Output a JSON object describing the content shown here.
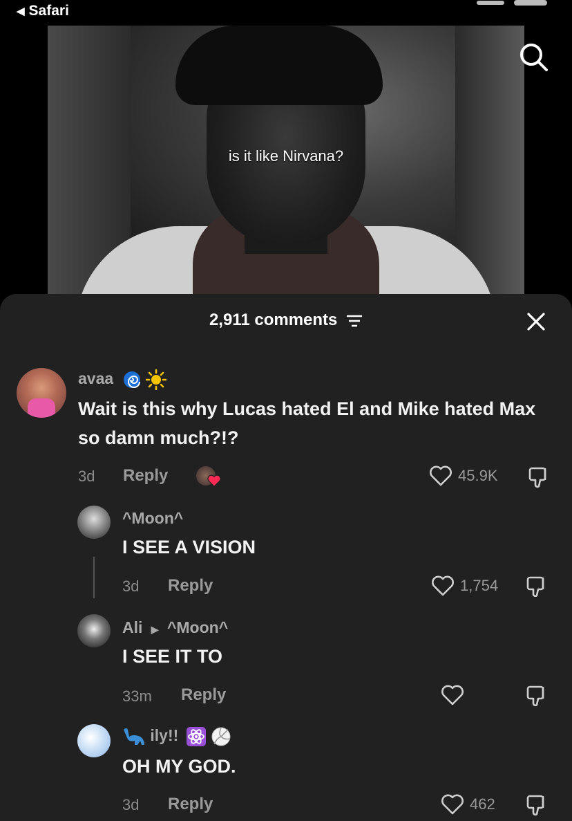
{
  "status_bar": {
    "back_label": "Safari"
  },
  "video": {
    "caption": "is it like Nirvana?"
  },
  "sheet": {
    "comments_count": "2,911 comments"
  },
  "comments": [
    {
      "username": "avaa",
      "text": "Wait is this why Lucas hated El and Mike hated Max so damn much?!?",
      "age": "3d",
      "reply_label": "Reply",
      "likes": "45.9K"
    },
    {
      "username": "^Moon^",
      "text": "I SEE A VISION",
      "age": "3d",
      "reply_label": "Reply",
      "likes": "1,754"
    },
    {
      "username": "Ali",
      "reply_to": "^Moon^",
      "text": "I SEE IT TO",
      "age": "33m",
      "reply_label": "Reply",
      "likes": ""
    },
    {
      "username": "ily!!",
      "text": "OH MY GOD.",
      "age": "3d",
      "reply_label": "Reply",
      "likes": "462"
    }
  ],
  "colors": {
    "sheet_bg": "#222122",
    "heart_red": "#ff2b55",
    "text_muted": "#9a9a9a"
  },
  "icons": [
    "back-triangle-icon",
    "search-icon",
    "filter-icon",
    "close-icon",
    "heart-icon",
    "dislike-icon",
    "spiral-emoji-icon",
    "sun-emoji-icon",
    "dinosaur-emoji-icon",
    "atom-emoji-icon",
    "volleyball-emoji-icon",
    "creator-liked-heart-icon"
  ]
}
